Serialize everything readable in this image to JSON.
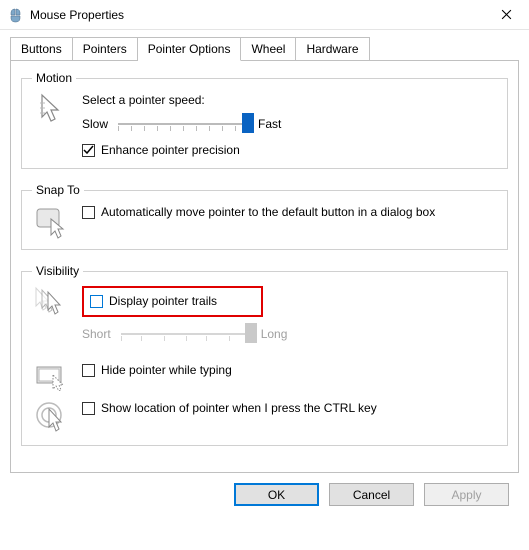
{
  "window": {
    "title": "Mouse Properties"
  },
  "tabs": {
    "buttons": "Buttons",
    "pointers": "Pointers",
    "pointer_options": "Pointer Options",
    "wheel": "Wheel",
    "hardware": "Hardware"
  },
  "motion": {
    "legend": "Motion",
    "select_speed": "Select a pointer speed:",
    "slow": "Slow",
    "fast": "Fast",
    "enhance": "Enhance pointer precision"
  },
  "snap": {
    "legend": "Snap To",
    "auto_move": "Automatically move pointer to the default button in a dialog box"
  },
  "visibility": {
    "legend": "Visibility",
    "trails": "Display pointer trails",
    "short": "Short",
    "long": "Long",
    "hide_typing": "Hide pointer while typing",
    "ctrl_locate": "Show location of pointer when I press the CTRL key"
  },
  "buttons": {
    "ok": "OK",
    "cancel": "Cancel",
    "apply": "Apply"
  }
}
